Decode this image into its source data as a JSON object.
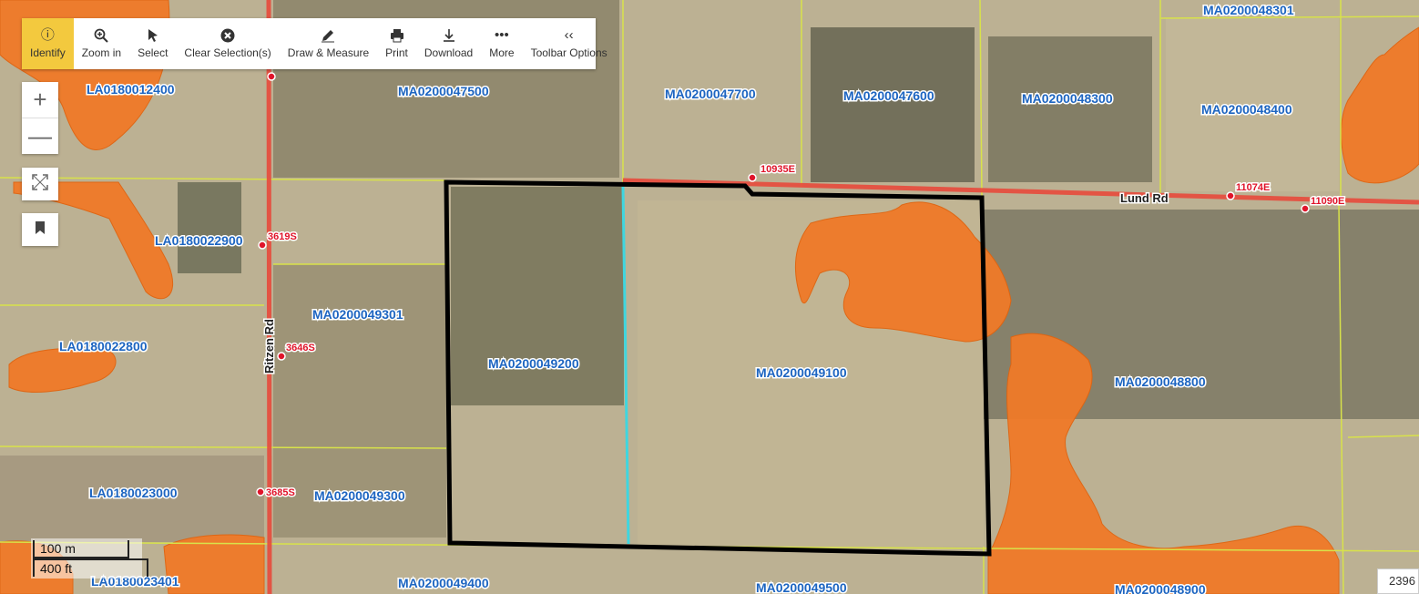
{
  "toolbar": {
    "identify": "Identify",
    "zoom_in": "Zoom in",
    "select": "Select",
    "clear_selection": "Clear Selection(s)",
    "draw_measure": "Draw & Measure",
    "print": "Print",
    "download": "Download",
    "more": "More",
    "toolbar_options": "Toolbar Options"
  },
  "parcels": [
    "LA0180012400",
    "MA0200047500",
    "MA0200047700",
    "MA0200047600",
    "MA0200048300",
    "MA0200048301",
    "MA0200048400",
    "LA0180022900",
    "MA0200049301",
    "LA0180022800",
    "MA0200049200",
    "MA0200049100",
    "MA0200048800",
    "LA0180023000",
    "MA0200049300",
    "LA0180023401",
    "MA0200049400",
    "MA0200049500",
    "MA0200048900"
  ],
  "roads": {
    "lund": "Lund Rd",
    "ritzen": "Ritzen Rd"
  },
  "addresses": [
    "10935E",
    "11074E",
    "11090E",
    "3619S",
    "3646S",
    "3685S"
  ],
  "scale": {
    "metric": "100 m",
    "imperial": "400 ft"
  },
  "coordinate_readout": "2396",
  "colors": {
    "wetland": "#f07a28",
    "road": "#e84a3c",
    "parcel_line": "#d8e24a",
    "label": "#1d65c1",
    "address": "#e0142a",
    "selection": "#000000",
    "split_line": "#3fd6df"
  }
}
